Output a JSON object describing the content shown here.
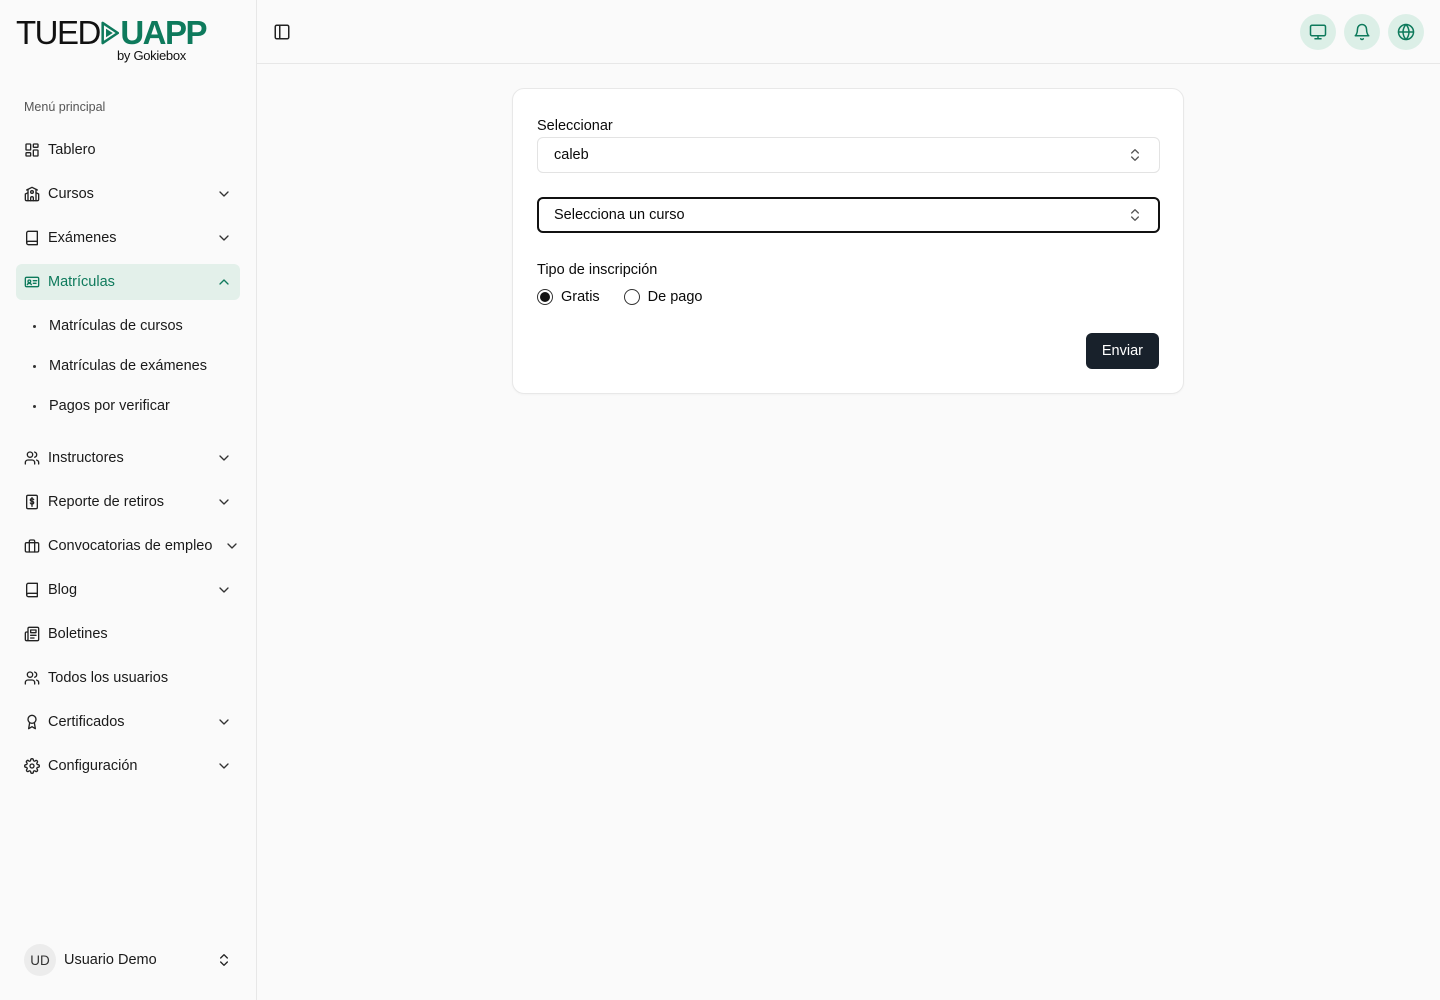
{
  "brand": {
    "logo_part1": "TUED",
    "logo_part2": "UAPP",
    "logo_sub": "by Gokiebox",
    "accent": "#0e7a5c"
  },
  "sidebar": {
    "menu_title": "Menú principal",
    "items": [
      {
        "label": "Tablero",
        "icon": "dashboard-icon"
      },
      {
        "label": "Cursos",
        "icon": "school-icon"
      },
      {
        "label": "Exámenes",
        "icon": "book-icon"
      },
      {
        "label": "Matrículas",
        "icon": "id-card-icon",
        "active": true
      },
      {
        "label": "Instructores",
        "icon": "users-icon"
      },
      {
        "label": "Reporte de retiros",
        "icon": "dollar-receipt-icon"
      },
      {
        "label": "Convocatorias de empleo",
        "icon": "briefcase-icon"
      },
      {
        "label": "Blog",
        "icon": "book-icon"
      },
      {
        "label": "Boletines",
        "icon": "newspaper-icon"
      },
      {
        "label": "Todos los usuarios",
        "icon": "users-icon"
      },
      {
        "label": "Certificados",
        "icon": "award-icon"
      },
      {
        "label": "Configuración",
        "icon": "gear-icon"
      }
    ],
    "subitems": [
      {
        "label": "Matrículas de cursos"
      },
      {
        "label": "Matrículas de exámenes"
      },
      {
        "label": "Pagos por verificar"
      }
    ],
    "user": {
      "initials": "UD",
      "name": "Usuario Demo"
    }
  },
  "topbar": {
    "buttons": [
      "monitor-icon",
      "bell-icon",
      "globe-icon"
    ]
  },
  "form": {
    "select_label": "Seleccionar",
    "user_value": "caleb",
    "course_placeholder": "Selecciona un curso",
    "type_label": "Tipo de inscripción",
    "options": [
      {
        "label": "Gratis",
        "checked": true
      },
      {
        "label": "De pago",
        "checked": false
      }
    ],
    "submit_label": "Enviar"
  }
}
